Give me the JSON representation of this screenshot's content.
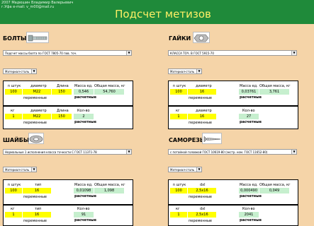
{
  "header": {
    "line1": "2007 Мадюшин Владимир Валерьевич",
    "line2": "г.Уфа  e-mail: v_m00@mail.ru",
    "title": "Подсчет метизов"
  },
  "colors": {
    "topbar": "#1f8a3a",
    "title": "#fff066",
    "yellow": "#ffff00",
    "green": "#c6efce",
    "bg": "#f5d4a8"
  },
  "bolts": {
    "title": "БОЛТЫ",
    "icon": "bolt-icon",
    "standard": "Подсчет массы болта по ГОСТ 7805-70 пов. точ.",
    "material": "Материал-сталь",
    "top": {
      "h1": "n штук",
      "h2": "диаметр",
      "h3": "Длина",
      "h4": "Масса ед.",
      "h5": "Общая масса, кг",
      "v1": "100",
      "v2": "M22",
      "v3": "150",
      "v4": "0,546",
      "v5": "54,760",
      "var": "переменные",
      "res": "расчетные"
    },
    "bot": {
      "h1": "кг",
      "h2": "диаметр",
      "h3": "Длина",
      "h4": "Кол-во",
      "v1": "1",
      "v2": "M22",
      "v3": "150",
      "v4": "2",
      "var": "переменные",
      "res": "расчетные"
    }
  },
  "nuts": {
    "title": "ГАЙКИ",
    "icon": "nut-icon",
    "standard": "КЛАССА ТОЧ. В ГОСТ 5915-70",
    "material": "Материал-сталь",
    "top": {
      "h1": "n штук",
      "h2": "диаметр",
      "h4": "Масса ед.",
      "h5": "Общая масса, кг",
      "v1": "100",
      "v2": "16",
      "v4": "0,03761",
      "v5": "3,761",
      "var": "переменные",
      "res": "расчетные"
    },
    "bot": {
      "h1": "кг",
      "h2": "диаметр",
      "h4": "Кол-во",
      "v1": "1",
      "v2": "16",
      "v4": "27",
      "var": "переменные",
      "res": "расчетные"
    }
  },
  "washers": {
    "title": "ШАЙБЫ",
    "icon": "washer-icon",
    "standard": "Нормальные 1 исполнения класса точности С ГОСТ 11371-78",
    "material": "Материал-сталь",
    "top": {
      "h1": "n штук",
      "h2": "тип",
      "h4": "Масса ед.",
      "h5": "Общая масса, кг",
      "v1": "100",
      "v2": "16",
      "v4": "0,01098",
      "v5": "1,098",
      "var": "переменные",
      "res": "расчетные"
    },
    "bot": {
      "h1": "кг",
      "h2": "тип",
      "h4": "Кол-во",
      "v1": "1",
      "v2": "16",
      "v4": "91",
      "var": "переменные",
      "res": "расчетные"
    }
  },
  "screws": {
    "title": "САМОРЕЗЫ",
    "icon": "screw-icon",
    "standard": "с потайной головкой ГОСТ 10619-80 (экстр. ном. ГОСТ 11652-80)",
    "material": "Материал-сталь",
    "top": {
      "h1": "n штук",
      "h2": "dxl",
      "h4": "Масса ед.",
      "h5": "Общая масса, кг",
      "v1": "100",
      "v2": "2,5x16",
      "v4": "0,000490",
      "v5": "0,049",
      "var": "переменные",
      "res": "расчетные"
    },
    "bot": {
      "h1": "кг",
      "h2": "dxl",
      "h4": "Кол-во",
      "v1": "1",
      "v2": "2,5x16",
      "v4": "2041",
      "var": "переменные",
      "res": "расчетные"
    }
  }
}
